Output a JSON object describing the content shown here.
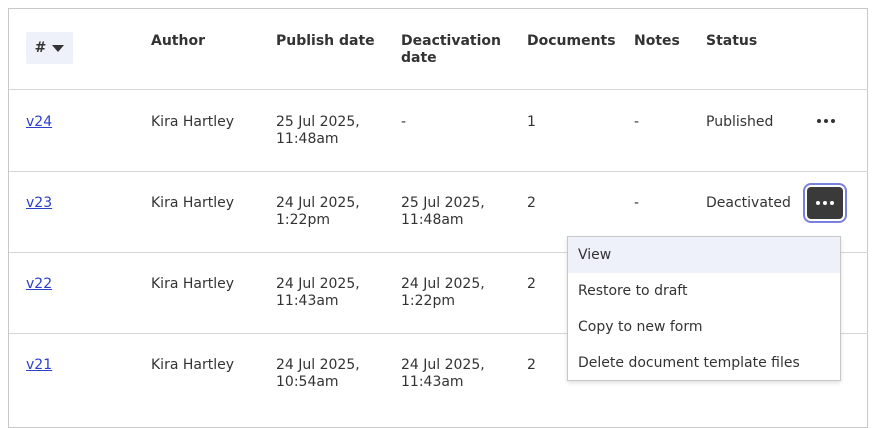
{
  "table": {
    "sort_label": "#",
    "headers": {
      "author": "Author",
      "publish_date": "Publish date",
      "deactivation_date_l1": "Deactivation",
      "deactivation_date_l2": "date",
      "documents": "Documents",
      "notes": "Notes",
      "status": "Status"
    },
    "rows": [
      {
        "version": "v24",
        "author": "Kira Hartley",
        "publish_l1": "25 Jul 2025,",
        "publish_l2": "11:48am",
        "deact_l1": "-",
        "deact_l2": "",
        "documents": "1",
        "notes": "-",
        "status": "Published"
      },
      {
        "version": "v23",
        "author": "Kira Hartley",
        "publish_l1": "24 Jul 2025,",
        "publish_l2": "1:22pm",
        "deact_l1": "25 Jul 2025,",
        "deact_l2": "11:48am",
        "documents": "2",
        "notes": "-",
        "status": "Deactivated"
      },
      {
        "version": "v22",
        "author": "Kira Hartley",
        "publish_l1": "24 Jul 2025,",
        "publish_l2": "11:43am",
        "deact_l1": "24 Jul 2025,",
        "deact_l2": "1:22pm",
        "documents": "2",
        "notes": "",
        "status": ""
      },
      {
        "version": "v21",
        "author": "Kira Hartley",
        "publish_l1": "24 Jul 2025,",
        "publish_l2": "10:54am",
        "deact_l1": "24 Jul 2025,",
        "deact_l2": "11:43am",
        "documents": "2",
        "notes": "",
        "status": ""
      }
    ]
  },
  "menu": {
    "items": [
      "View",
      "Restore to draft",
      "Copy to new form",
      "Delete document template files"
    ],
    "highlighted": "View"
  },
  "icons": {
    "sort": "caret-down-icon",
    "row_actions": "more-horizontal-icon"
  },
  "colors": {
    "link": "#2b3fc8",
    "sort_bg": "#eef0fa",
    "active_button": "#3a3a3a",
    "focus_ring": "#7a80e0"
  }
}
